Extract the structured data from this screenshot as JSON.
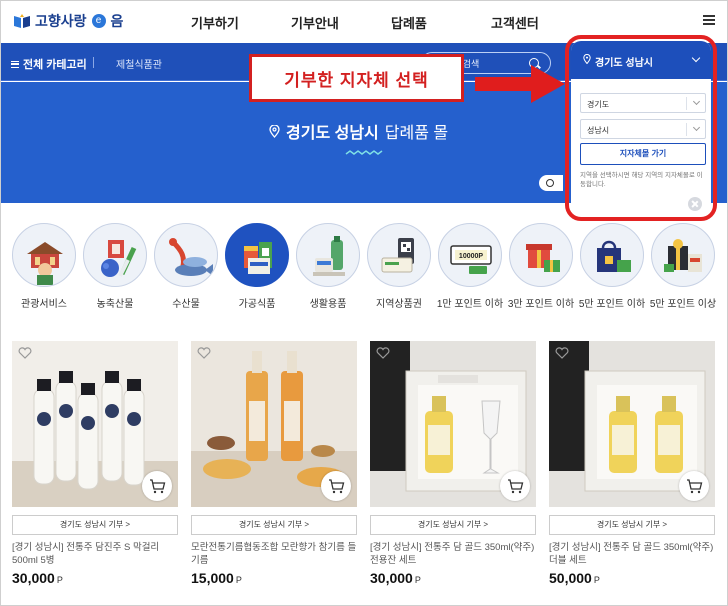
{
  "header": {
    "logo_text_1": "고향사랑",
    "logo_e": "e",
    "logo_text_2": "음",
    "nav": [
      "기부하기",
      "기부안내",
      "답례품",
      "고객센터"
    ]
  },
  "catbar": {
    "all_label": "전체 카테고리",
    "sub_label": "제철식품관",
    "search_placeholder": "제 검색"
  },
  "banner": {
    "region": "경기도 성남시",
    "suffix": "답례품 몰"
  },
  "callout": {
    "text": "기부한 지자체 선택"
  },
  "region_panel": {
    "header": "경기도 성남시",
    "province": "경기도",
    "city": "성남시",
    "go_label": "지자체몰 가기",
    "note": "지역을 선택하시면 해당 지역의 지자체몰로 이동합니다."
  },
  "categories": [
    {
      "label": "관광서비스"
    },
    {
      "label": "농축산물"
    },
    {
      "label": "수산물"
    },
    {
      "label": "가공식품"
    },
    {
      "label": "생활용품"
    },
    {
      "label": "지역상품권"
    },
    {
      "label": "1만 포인트 이하"
    },
    {
      "label": "3만 포인트 이하"
    },
    {
      "label": "5만 포인트 이하"
    },
    {
      "label": "5만 포인트 이상"
    }
  ],
  "voucher_text": "10000P",
  "products": [
    {
      "donate": "경기도 성남시 기부 >",
      "title": "[경기 성남시] 전통주 담진주 S 막걸리 500ml 5병",
      "price": "30,000",
      "unit": "P"
    },
    {
      "donate": "경기도 성남시 기부 >",
      "title": "모란전통기름협동조합 모란향가 참기름 들기름",
      "price": "15,000",
      "unit": "P"
    },
    {
      "donate": "경기도 성남시 기부 >",
      "title": "[경기 성남시] 전통주 담 골드 350ml(약주) 전용잔 세트",
      "price": "30,000",
      "unit": "P"
    },
    {
      "donate": "경기도 성남시 기부 >",
      "title": "[경기 성남시] 전통주 담 골드 350ml(약주) 더블 세트",
      "price": "50,000",
      "unit": "P"
    }
  ]
}
